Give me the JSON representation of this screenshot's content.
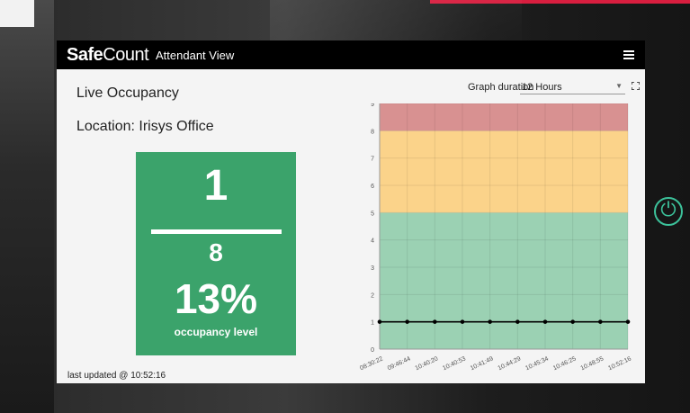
{
  "app": {
    "logo_bold": "Safe",
    "logo_light": "Count",
    "view_title": "Attendant View",
    "menu_icon": "hamburger-menu-icon"
  },
  "main": {
    "heading": "Live Occupancy",
    "location": "Location: Irisys Office",
    "occupancy": {
      "current": "1",
      "max": "8",
      "percent": "13%",
      "label": "occupancy level",
      "color": "#3ba36b"
    },
    "last_updated": "last updated @ 10:52:16"
  },
  "graph": {
    "duration_label": "Graph duration",
    "duration_value": "12 Hours",
    "fullscreen_icon": "fullscreen-icon"
  },
  "chart_data": {
    "type": "line",
    "x": [
      "08:30:22",
      "09:46:44",
      "10:40:20",
      "10:40:53",
      "10:41:49",
      "10:44:29",
      "10:45:34",
      "10:46:25",
      "10:48:55",
      "10:52:16"
    ],
    "series": [
      {
        "values": [
          1,
          1,
          1,
          1,
          1,
          1,
          1,
          1,
          1,
          1
        ],
        "color": "#000000"
      }
    ],
    "ylim": [
      0,
      9
    ],
    "yticks": [
      "0",
      "1",
      "2",
      "3",
      "4",
      "5",
      "6",
      "7",
      "8",
      "9"
    ],
    "bands": [
      {
        "from": 0,
        "to": 5,
        "color": "#9bd1b3"
      },
      {
        "from": 5,
        "to": 8,
        "color": "#fbd38a"
      },
      {
        "from": 8,
        "to": 9,
        "color": "#d89191"
      }
    ],
    "grid": true
  },
  "device": {
    "power_icon": "power-icon",
    "accent_color": "#3cc19a"
  }
}
